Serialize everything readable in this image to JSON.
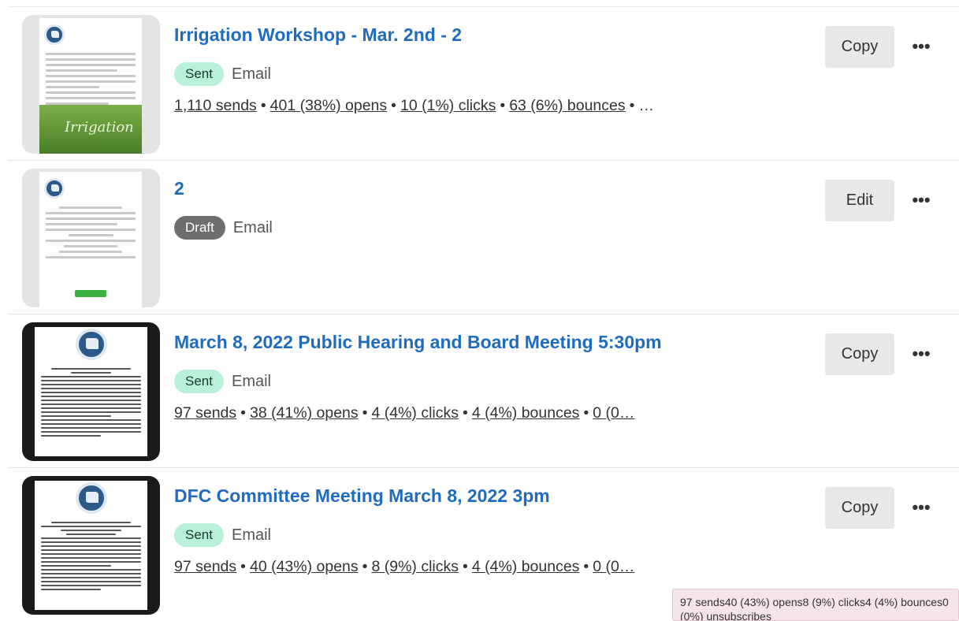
{
  "campaigns": [
    {
      "title": "Irrigation Workshop - Mar. 2nd - 2",
      "status": "Sent",
      "type": "Email",
      "thumbnail": {
        "style": "light",
        "banner_text": "Irrigation"
      },
      "stats": [
        "1,110 sends",
        "401 (38%) opens",
        "10 (1%) clicks",
        "63 (6%) bounces"
      ],
      "stats_tail": "…",
      "action": "Copy"
    },
    {
      "title": "2",
      "status": "Draft",
      "type": "Email",
      "thumbnail": {
        "style": "light"
      },
      "stats": [],
      "stats_tail": "",
      "action": "Edit"
    },
    {
      "title": "March 8, 2022 Public Hearing and Board Meeting 5:30pm",
      "status": "Sent",
      "type": "Email",
      "thumbnail": {
        "style": "dark"
      },
      "stats": [
        "97 sends",
        "38 (41%) opens",
        "4 (4%) clicks",
        "4 (4%) bounces"
      ],
      "stats_tail": "0 (0…",
      "action": "Copy"
    },
    {
      "title": "DFC Committee Meeting March 8, 2022 3pm",
      "status": "Sent",
      "type": "Email",
      "thumbnail": {
        "style": "dark"
      },
      "stats": [
        "97 sends",
        "40 (43%) opens",
        "8 (9%) clicks",
        "4 (4%) bounces"
      ],
      "stats_tail": "0 (0…",
      "action": "Copy"
    }
  ],
  "more_label": "•••",
  "tooltip": "97 sends40 (43%) opens8 (9%) clicks4 (4%) bounces0 (0%) unsubscribes",
  "colors": {
    "title": "#1f6cbf",
    "sent_badge": "#b8f0d9",
    "draft_badge": "#6e6e6e"
  }
}
